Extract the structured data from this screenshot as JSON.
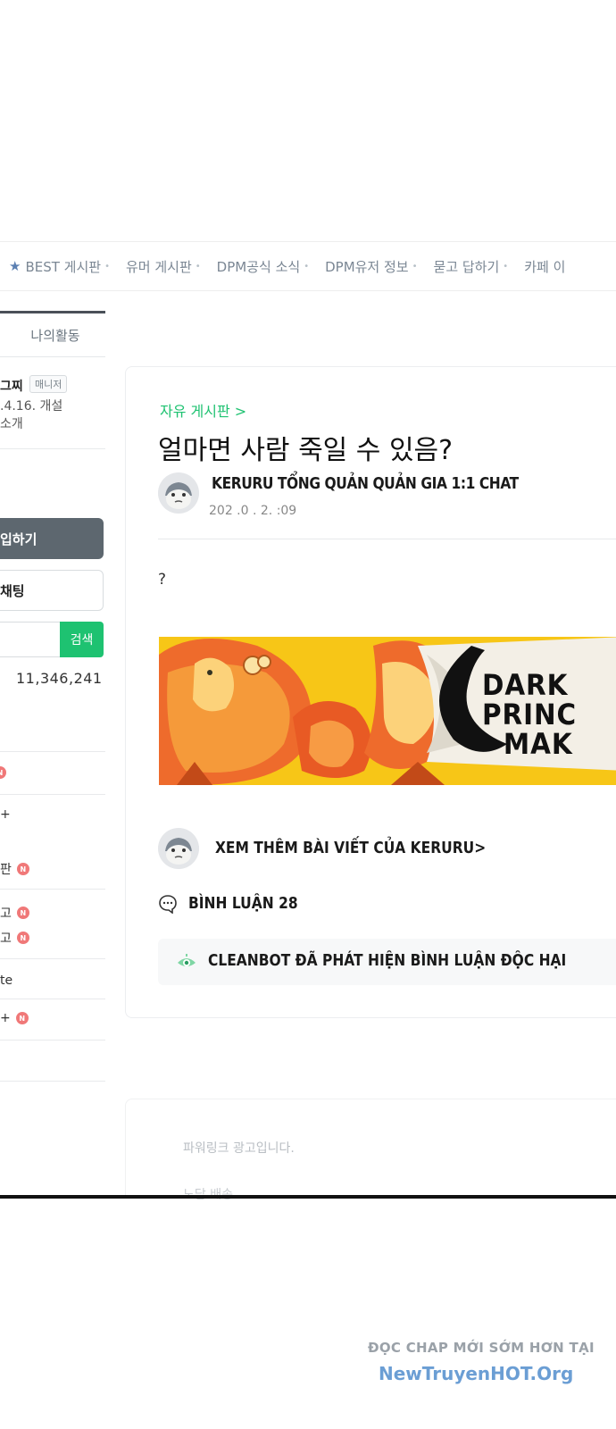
{
  "nav": {
    "items": [
      {
        "label": "BEST 게시판",
        "icon": "star-icon"
      },
      {
        "label": "유머 게시판"
      },
      {
        "label": "DPM공식 소식"
      },
      {
        "label": "DPM유저 정보"
      },
      {
        "label": "묻고 답하기"
      },
      {
        "label": "카페 이"
      }
    ]
  },
  "sidebar": {
    "tab_label": "나의활동",
    "cafe_name": "그찌",
    "manager_badge": "매니저",
    "created": ".4.16. 개설",
    "intro": "소개",
    "join_button": "입하기",
    "chat_button": "채팅",
    "search_button": "검색",
    "member_count": "11,346,241",
    "menu": [
      {
        "label": "",
        "new": true
      },
      {
        "label": "+",
        "new": false
      },
      {
        "label": "판",
        "new": true
      },
      {
        "label": "고",
        "new": true
      },
      {
        "label": "고",
        "new": true
      },
      {
        "label": "te",
        "new": false
      },
      {
        "label": "+",
        "new": true
      }
    ],
    "new_badge": "N"
  },
  "post": {
    "board": "자유 게시판 >",
    "title": "얼마면 사람 죽일 수 있음?",
    "author": "KERURU TỔNG QUẢN QUẢN GIA 1:1 CHAT",
    "date": "202  .0  .  2.      :09",
    "body": "?",
    "banner_text_1": "DARK",
    "banner_text_2": "PRINC",
    "banner_text_3": "MAK",
    "more_posts": "XEM THÊM BÀI VIẾT CỦA KERURU>",
    "comments": "BÌNH LUẬN 28",
    "cleanbot": "CLEANBOT ĐÃ PHÁT HIỆN BÌNH LUẬN ĐỘC HẠI"
  },
  "ad": {
    "label": "파워링크 광고입니다.",
    "faded": "노담 배송"
  },
  "watermark": {
    "line1": "ĐỌC CHAP MỚI SỚM HƠN TẠI",
    "line2": "NewTruyenHOT.Org"
  },
  "colors": {
    "accent_green": "#1ec271",
    "join_gray": "#5d676f",
    "new_badge": "#f07878",
    "banner_yellow": "#f7c617",
    "banner_red": "#e8442a"
  }
}
